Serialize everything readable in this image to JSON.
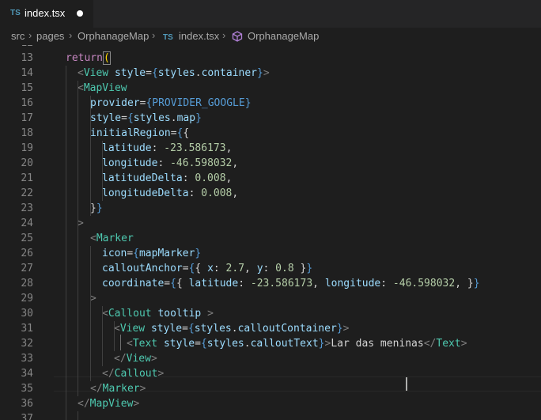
{
  "tab": {
    "badge": "TS",
    "title": "index.tsx"
  },
  "breadcrumb": {
    "src": "src",
    "pages": "pages",
    "folder": "OrphanageMap",
    "file_badge": "TS",
    "file": "index.tsx",
    "symbol": "OrphanageMap"
  },
  "editor": {
    "top_partial_line": "12",
    "lines": [
      {
        "n": "13",
        "parts": [
          [
            "k",
            "return"
          ],
          [
            "y",
            "("
          ]
        ]
      },
      {
        "n": "14",
        "parts": [
          [
            "g",
            "<"
          ],
          [
            "t",
            "View"
          ],
          [
            "p",
            " "
          ],
          [
            "a",
            "style"
          ],
          [
            "p",
            "="
          ],
          [
            "c",
            "{"
          ],
          [
            "a",
            "styles"
          ],
          [
            "p",
            "."
          ],
          [
            "a",
            "container"
          ],
          [
            "c",
            "}"
          ],
          [
            "g",
            ">"
          ]
        ]
      },
      {
        "n": "15",
        "parts": [
          [
            "g",
            "<"
          ],
          [
            "t",
            "MapView"
          ]
        ]
      },
      {
        "n": "16",
        "parts": [
          [
            "a",
            "provider"
          ],
          [
            "p",
            "="
          ],
          [
            "c",
            "{"
          ],
          [
            "c",
            "PROVIDER_GOOGLE"
          ],
          [
            "c",
            "}"
          ]
        ]
      },
      {
        "n": "17",
        "parts": [
          [
            "a",
            "style"
          ],
          [
            "p",
            "="
          ],
          [
            "c",
            "{"
          ],
          [
            "a",
            "styles"
          ],
          [
            "p",
            "."
          ],
          [
            "a",
            "map"
          ],
          [
            "c",
            "}"
          ]
        ]
      },
      {
        "n": "18",
        "parts": [
          [
            "a",
            "initialRegion"
          ],
          [
            "p",
            "="
          ],
          [
            "c",
            "{"
          ],
          [
            "p",
            "{"
          ]
        ]
      },
      {
        "n": "19",
        "parts": [
          [
            "a",
            "latitude"
          ],
          [
            "p",
            ": "
          ],
          [
            "n",
            "-23.586173"
          ],
          [
            "p",
            ","
          ]
        ]
      },
      {
        "n": "20",
        "parts": [
          [
            "a",
            "longitude"
          ],
          [
            "p",
            ": "
          ],
          [
            "n",
            "-46.598032"
          ],
          [
            "p",
            ","
          ]
        ]
      },
      {
        "n": "21",
        "parts": [
          [
            "a",
            "latitudeDelta"
          ],
          [
            "p",
            ": "
          ],
          [
            "n",
            "0.008"
          ],
          [
            "p",
            ","
          ]
        ]
      },
      {
        "n": "22",
        "parts": [
          [
            "a",
            "longitudeDelta"
          ],
          [
            "p",
            ": "
          ],
          [
            "n",
            "0.008"
          ],
          [
            "p",
            ","
          ]
        ]
      },
      {
        "n": "23",
        "parts": [
          [
            "p",
            "}"
          ],
          [
            "c",
            "}"
          ]
        ]
      },
      {
        "n": "24",
        "parts": [
          [
            "g",
            ">"
          ]
        ]
      },
      {
        "n": "25",
        "parts": [
          [
            "g",
            "<"
          ],
          [
            "t",
            "Marker"
          ]
        ]
      },
      {
        "n": "26",
        "parts": [
          [
            "a",
            "icon"
          ],
          [
            "p",
            "="
          ],
          [
            "c",
            "{"
          ],
          [
            "a",
            "mapMarker"
          ],
          [
            "c",
            "}"
          ]
        ]
      },
      {
        "n": "27",
        "parts": [
          [
            "a",
            "calloutAnchor"
          ],
          [
            "p",
            "="
          ],
          [
            "c",
            "{"
          ],
          [
            "p",
            "{ "
          ],
          [
            "a",
            "x"
          ],
          [
            "p",
            ": "
          ],
          [
            "n",
            "2.7"
          ],
          [
            "p",
            ", "
          ],
          [
            "a",
            "y"
          ],
          [
            "p",
            ": "
          ],
          [
            "n",
            "0.8"
          ],
          [
            "p",
            " }"
          ],
          [
            "c",
            "}"
          ]
        ]
      },
      {
        "n": "28",
        "parts": [
          [
            "a",
            "coordinate"
          ],
          [
            "p",
            "="
          ],
          [
            "c",
            "{"
          ],
          [
            "p",
            "{ "
          ],
          [
            "a",
            "latitude"
          ],
          [
            "p",
            ": "
          ],
          [
            "n",
            "-23.586173"
          ],
          [
            "p",
            ", "
          ],
          [
            "a",
            "longitude"
          ],
          [
            "p",
            ": "
          ],
          [
            "n",
            "-46.598032"
          ],
          [
            "p",
            ", }"
          ],
          [
            "c",
            "}"
          ]
        ]
      },
      {
        "n": "29",
        "parts": [
          [
            "g",
            ">"
          ]
        ]
      },
      {
        "n": "30",
        "parts": [
          [
            "g",
            "<"
          ],
          [
            "t",
            "Callout"
          ],
          [
            "p",
            " "
          ],
          [
            "a",
            "tooltip"
          ],
          [
            "p",
            " "
          ],
          [
            "g",
            ">"
          ]
        ]
      },
      {
        "n": "31",
        "parts": [
          [
            "g",
            "<"
          ],
          [
            "t",
            "View"
          ],
          [
            "p",
            " "
          ],
          [
            "a",
            "style"
          ],
          [
            "p",
            "="
          ],
          [
            "c",
            "{"
          ],
          [
            "a",
            "styles"
          ],
          [
            "p",
            "."
          ],
          [
            "a",
            "calloutContainer"
          ],
          [
            "c",
            "}"
          ],
          [
            "g",
            ">"
          ]
        ]
      },
      {
        "n": "32",
        "parts": [
          [
            "g",
            "<"
          ],
          [
            "t",
            "Text"
          ],
          [
            "p",
            " "
          ],
          [
            "a",
            "style"
          ],
          [
            "p",
            "="
          ],
          [
            "c",
            "{"
          ],
          [
            "a",
            "styles"
          ],
          [
            "p",
            "."
          ],
          [
            "a",
            "calloutText"
          ],
          [
            "c",
            "}"
          ],
          [
            "g",
            ">"
          ],
          [
            "p",
            "Lar das meninas"
          ],
          [
            "g",
            "</"
          ],
          [
            "t",
            "Text"
          ],
          [
            "g",
            ">"
          ]
        ]
      },
      {
        "n": "33",
        "parts": [
          [
            "g",
            "</"
          ],
          [
            "t",
            "View"
          ],
          [
            "g",
            ">"
          ]
        ]
      },
      {
        "n": "34",
        "parts": [
          [
            "g",
            "</"
          ],
          [
            "t",
            "Callout"
          ],
          [
            "g",
            ">"
          ]
        ]
      },
      {
        "n": "35",
        "parts": [
          [
            "g",
            "</"
          ],
          [
            "t",
            "Marker"
          ],
          [
            "g",
            ">"
          ]
        ]
      },
      {
        "n": "36",
        "parts": [
          [
            "g",
            "</"
          ],
          [
            "t",
            "MapView"
          ],
          [
            "g",
            ">"
          ]
        ]
      },
      {
        "n": "37",
        "parts": []
      }
    ]
  },
  "colors": {
    "background": "#1e1e1e",
    "tabbar": "#252526",
    "keyword": "#c586c0",
    "tag": "#4ec9b0",
    "attribute": "#9cdcfe",
    "brace": "#569cd6",
    "number": "#b5cea8",
    "punctuation": "#808080",
    "ts_badge": "#519aba"
  }
}
